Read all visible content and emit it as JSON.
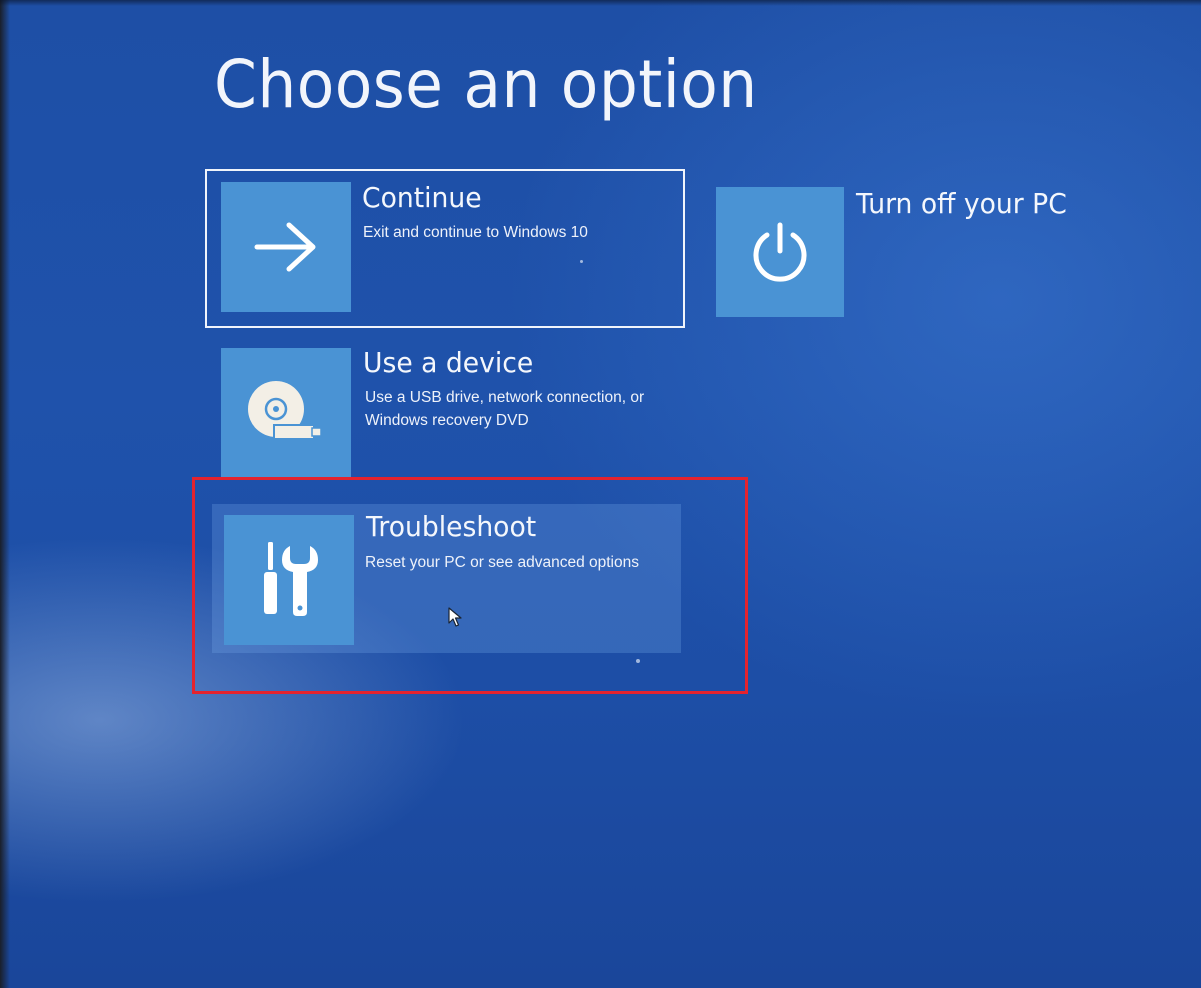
{
  "screen": {
    "title": "Choose an option",
    "background_color": "#1f52ab",
    "tile_color": "#4a93d4"
  },
  "options": {
    "continue": {
      "title": "Continue",
      "description": "Exit and continue to Windows 10",
      "icon": "arrow-right-icon"
    },
    "turn_off": {
      "title": "Turn off your PC",
      "icon": "power-icon"
    },
    "use_device": {
      "title": "Use a device",
      "description_line1": "Use a USB drive, network connection, or",
      "description_line2": "Windows recovery DVD",
      "icon": "disc-usb-icon"
    },
    "troubleshoot": {
      "title": "Troubleshoot",
      "description": "Reset your PC or see advanced options",
      "icon": "tools-icon"
    }
  },
  "annotation": {
    "highlight_color": "#e4232e",
    "highlighted_option": "Troubleshoot"
  }
}
